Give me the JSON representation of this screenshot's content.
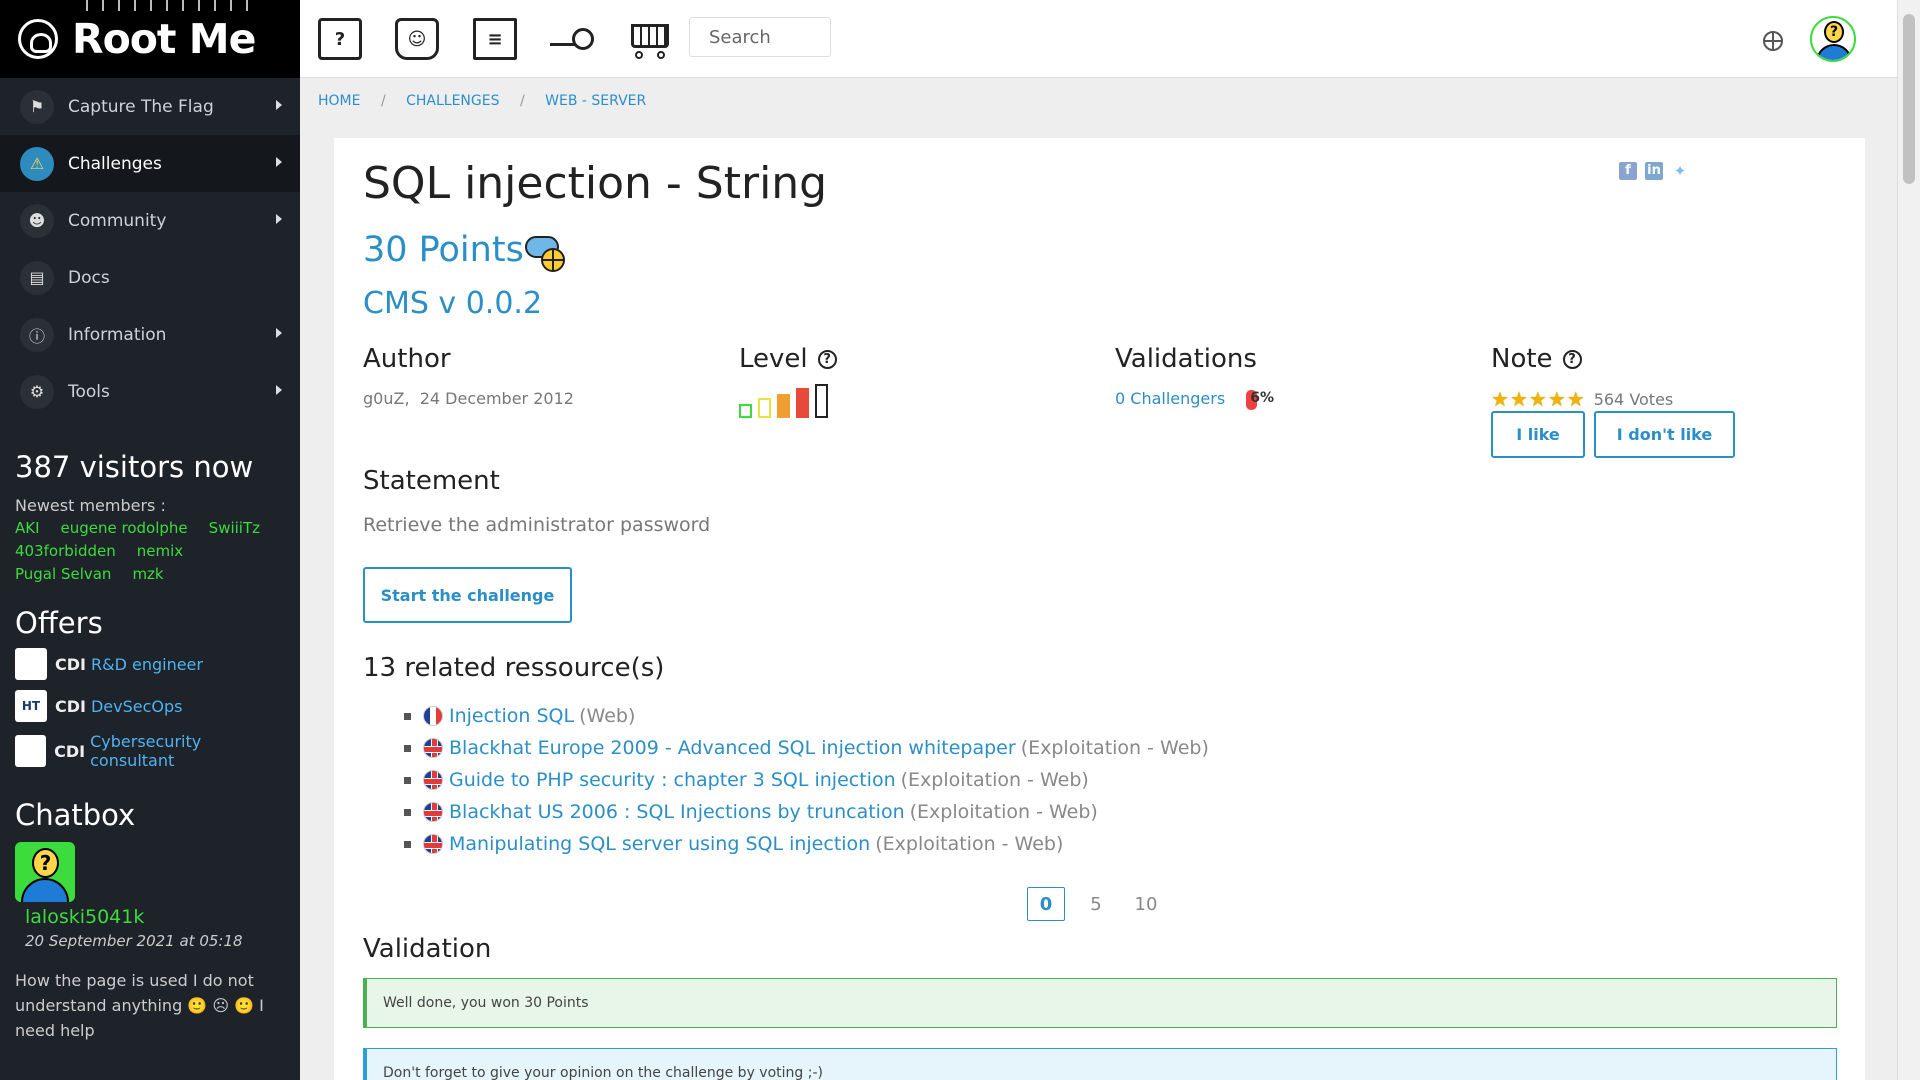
{
  "app": {
    "logo_text": "Root Me"
  },
  "sidebar": {
    "items": [
      {
        "label": "Capture The Flag",
        "icon": "flag-icon",
        "has_arrow": true
      },
      {
        "label": "Challenges",
        "icon": "challenge-icon",
        "has_arrow": true,
        "active": true
      },
      {
        "label": "Community",
        "icon": "community-icon",
        "has_arrow": true
      },
      {
        "label": "Docs",
        "icon": "docs-icon",
        "has_arrow": false
      },
      {
        "label": "Information",
        "icon": "information-icon",
        "has_arrow": true
      },
      {
        "label": "Tools",
        "icon": "tools-icon",
        "has_arrow": true
      }
    ],
    "visitors": "387 visitors now",
    "newest_label": "Newest members :",
    "members": [
      "AKI",
      "eugene rodolphe",
      "SwiiiTz",
      "403forbidden",
      "nemix",
      "Pugal Selvan",
      "mzk"
    ],
    "offers_title": "Offers",
    "offers": [
      {
        "type": "CDI",
        "title": "R&D engineer",
        "logo": ""
      },
      {
        "type": "CDI",
        "title": "DevSecOps",
        "logo": "HT"
      },
      {
        "type": "CDI",
        "title": "Cybersecurity consultant",
        "logo": ""
      }
    ],
    "chatbox_title": "Chatbox",
    "chat": {
      "user": "laloski5041k",
      "date": "20 September 2021 at 05:18",
      "message_1": "How the page is used I do not understand anything",
      "message_2": "I need help"
    }
  },
  "topbar": {
    "icons": [
      "faq-icon",
      "teacher-icon",
      "document-icon",
      "radar-icon",
      "shop-cart-icon"
    ],
    "search_placeholder": "Search"
  },
  "breadcrumb": [
    "HOME",
    "CHALLENGES",
    "WEB - SERVER"
  ],
  "challenge": {
    "title": "SQL injection - String",
    "points": "30 Points",
    "subtitle": "CMS v 0.0.2",
    "author_heading": "Author",
    "author": "g0uZ,",
    "date": "24 December 2012",
    "level_heading": "Level",
    "level_value": 4,
    "level_max": 5,
    "validations_heading": "Validations",
    "challengers": "0 Challengers",
    "validation_percent": "6%",
    "note_heading": "Note",
    "stars": 5,
    "votes": "564 Votes",
    "like_label": "I like",
    "dislike_label": "I don't like",
    "statement_heading": "Statement",
    "statement": "Retrieve the administrator password",
    "start_label": "Start the challenge",
    "resources_heading": "13 related ressource(s)",
    "resources": [
      {
        "flag": "fr",
        "title": "Injection SQL",
        "category": "(Web)"
      },
      {
        "flag": "uk",
        "title": "Blackhat Europe 2009 - Advanced SQL injection whitepaper",
        "category": "(Exploitation - Web)"
      },
      {
        "flag": "uk",
        "title": "Guide to PHP security : chapter 3 SQL injection",
        "category": "(Exploitation - Web)"
      },
      {
        "flag": "uk",
        "title": "Blackhat US 2006 : SQL Injections by truncation",
        "category": "(Exploitation - Web)"
      },
      {
        "flag": "uk",
        "title": "Manipulating SQL server using SQL injection",
        "category": "(Exploitation - Web)"
      }
    ],
    "pages": [
      "0",
      "5",
      "10"
    ],
    "active_page": "0",
    "validation_heading": "Validation",
    "success_message": "Well done, you won 30 Points",
    "info_message": "Don't forget to give your opinion on the challenge by voting ;-)"
  },
  "colors": {
    "accent": "#2b8fc7",
    "sidebar_bg": "#1e2229",
    "member_green": "#3ddc3d",
    "level_colors": [
      "#3ddc3d",
      "#e8e440",
      "#f0a030",
      "#e84a3a",
      "#222222"
    ]
  }
}
